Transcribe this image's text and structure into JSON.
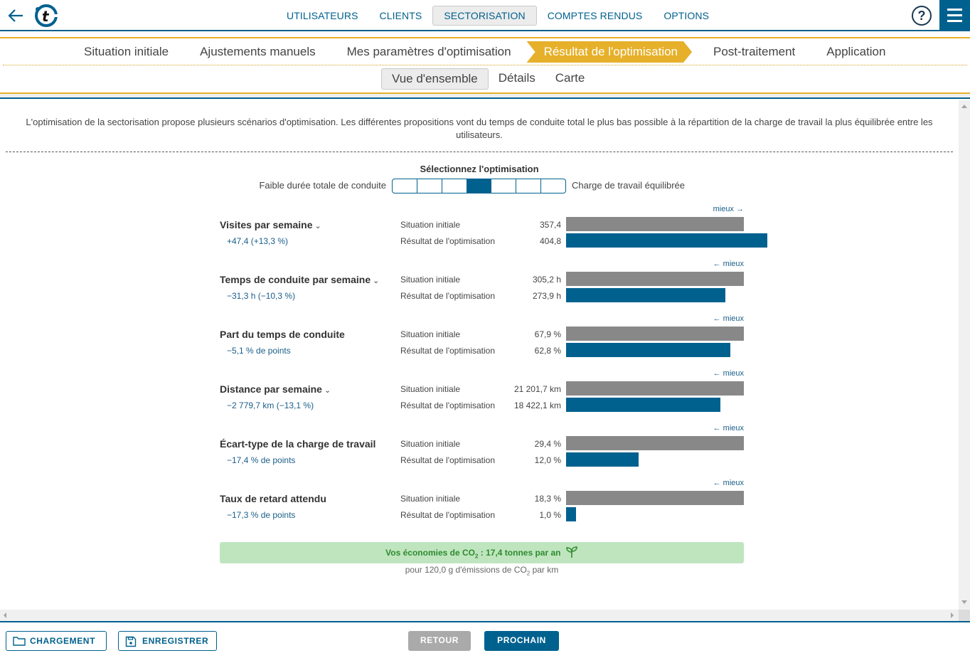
{
  "nav": {
    "items": [
      {
        "label": "UTILISATEURS",
        "active": false
      },
      {
        "label": "CLIENTS",
        "active": false
      },
      {
        "label": "SECTORISATION",
        "active": true
      },
      {
        "label": "COMPTES RENDUS",
        "active": false
      },
      {
        "label": "OPTIONS",
        "active": false
      }
    ],
    "help_label": "?",
    "brand_color": "#00618f"
  },
  "steps": {
    "items": [
      {
        "label": "Situation initiale",
        "active": false
      },
      {
        "label": "Ajustements manuels",
        "active": false
      },
      {
        "label": "Mes paramètres d'optimisation",
        "active": false
      },
      {
        "label": "Résultat de l'optimisation",
        "active": true
      },
      {
        "label": "Post-traitement",
        "active": false
      },
      {
        "label": "Application",
        "active": false
      }
    ],
    "accent_color": "#e6b02a"
  },
  "subtabs": {
    "items": [
      {
        "label": "Vue d'ensemble",
        "active": true
      },
      {
        "label": "Détails",
        "active": false
      },
      {
        "label": "Carte",
        "active": false
      }
    ]
  },
  "intro": "L'optimisation de la sectorisation propose plusieurs scénarios d'optimisation. Les différentes propositions vont du temps de conduite total le plus bas possible à la répartition de la charge de travail la plus équilibrée entre les utilisateurs.",
  "selector": {
    "title": "Sélectionnez l'optimisation",
    "left_label": "Faible durée totale de conduite",
    "right_label": "Charge de travail équilibrée",
    "segments": 7,
    "selected_index": 3
  },
  "labels": {
    "initial": "Situation initiale",
    "result": "Résultat de l'optimisation"
  },
  "metrics": [
    {
      "title": "Visites par semaine",
      "expandable": true,
      "delta": "+47,4 (+13,3 %)",
      "better": "mieux →",
      "initial_text": "357,4",
      "result_text": "404,8",
      "initial": 357.4,
      "result": 404.8
    },
    {
      "title": "Temps de conduite par semaine",
      "expandable": true,
      "delta": "−31,3 h (−10,3 %)",
      "better": "← mieux",
      "initial_text": "305,2 h",
      "result_text": "273,9 h",
      "initial": 305.2,
      "result": 273.9
    },
    {
      "title": "Part du temps de conduite",
      "expandable": false,
      "delta": "−5,1 % de points",
      "better": "← mieux",
      "initial_text": "67,9 %",
      "result_text": "62,8 %",
      "initial": 67.9,
      "result": 62.8
    },
    {
      "title": "Distance par semaine",
      "expandable": true,
      "delta": "−2 779,7 km (−13,1 %)",
      "better": "← mieux",
      "initial_text": "21 201,7 km",
      "result_text": "18 422,1 km",
      "initial": 21201.7,
      "result": 18422.1
    },
    {
      "title": "Écart-type de la charge de travail",
      "expandable": false,
      "delta": "−17,4 % de points",
      "better": "← mieux",
      "initial_text": "29,4 %",
      "result_text": "12,0 %",
      "initial": 29.4,
      "result": 12.0
    },
    {
      "title": "Taux de retard attendu",
      "expandable": false,
      "delta": "−17,3 % de points",
      "better": "← mieux",
      "initial_text": "18,3 %",
      "result_text": "1,0 %",
      "initial": 18.3,
      "result": 1.0
    }
  ],
  "co2": {
    "prefix": "Vos économies de CO",
    "sub": "2",
    "suffix": " : 17,4 tonnes par an",
    "note_prefix": "pour 120,0 g d'émissions de CO",
    "note_sub": "2",
    "note_suffix": " par km"
  },
  "footer": {
    "load": "CHARGEMENT",
    "save": "ENREGISTRER",
    "back": "RETOUR",
    "next": "PROCHAIN"
  },
  "colors": {
    "initial_bar": "#888888",
    "result_bar": "#00618f",
    "co2_bg": "#bfe5bf",
    "co2_text": "#2e8b2e"
  }
}
